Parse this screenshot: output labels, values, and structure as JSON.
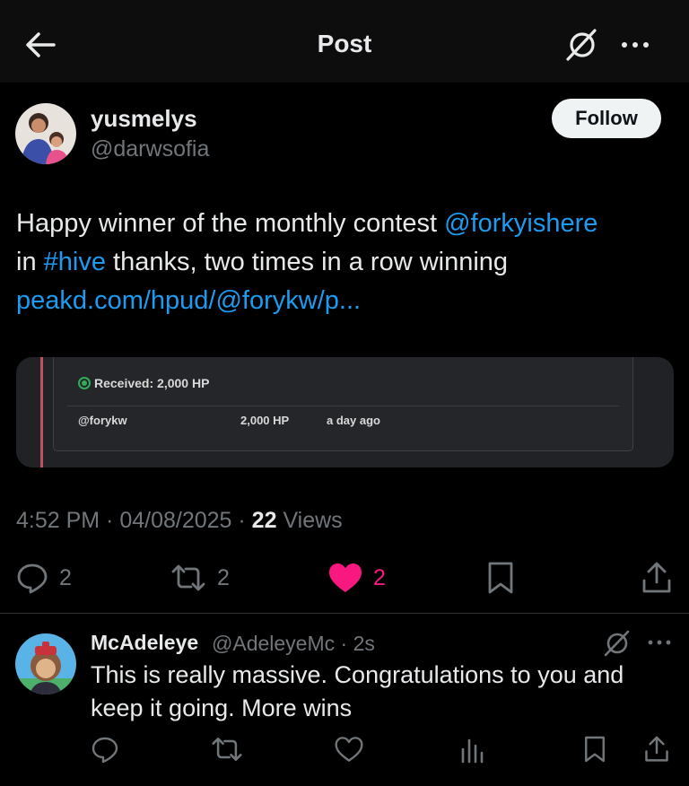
{
  "header": {
    "title": "Post",
    "back_icon": "arrow-left-icon",
    "grok_icon": "grok-icon",
    "more_icon": "more-horizontal-icon"
  },
  "post": {
    "author_name": "yusmelys",
    "author_handle": "@darwsofia",
    "follow_label": "Follow",
    "text": {
      "part1": "Happy winner of the monthly contest ",
      "mention": "@forkyishere",
      "part2": "in ",
      "hashtag": "#hive",
      "part3": " thanks, two times in a row winning",
      "link": "peakd.com/hpud/@forykw/p..."
    },
    "media": {
      "received": "Received: 2,000 HP",
      "from": "@forykw",
      "amount": "2,000 HP",
      "when": "a day ago"
    },
    "time": "4:52 PM",
    "date": "04/08/2025",
    "views_count": "22",
    "views_label": "Views",
    "replies": "2",
    "reposts": "2",
    "likes": "2",
    "like_color": "#f91880"
  },
  "reply": {
    "name": "McAdeleye",
    "handle_time": "@AdeleyeMc · 2s",
    "text": "This is really massive. Congratulations to you and keep it going. More wins"
  }
}
